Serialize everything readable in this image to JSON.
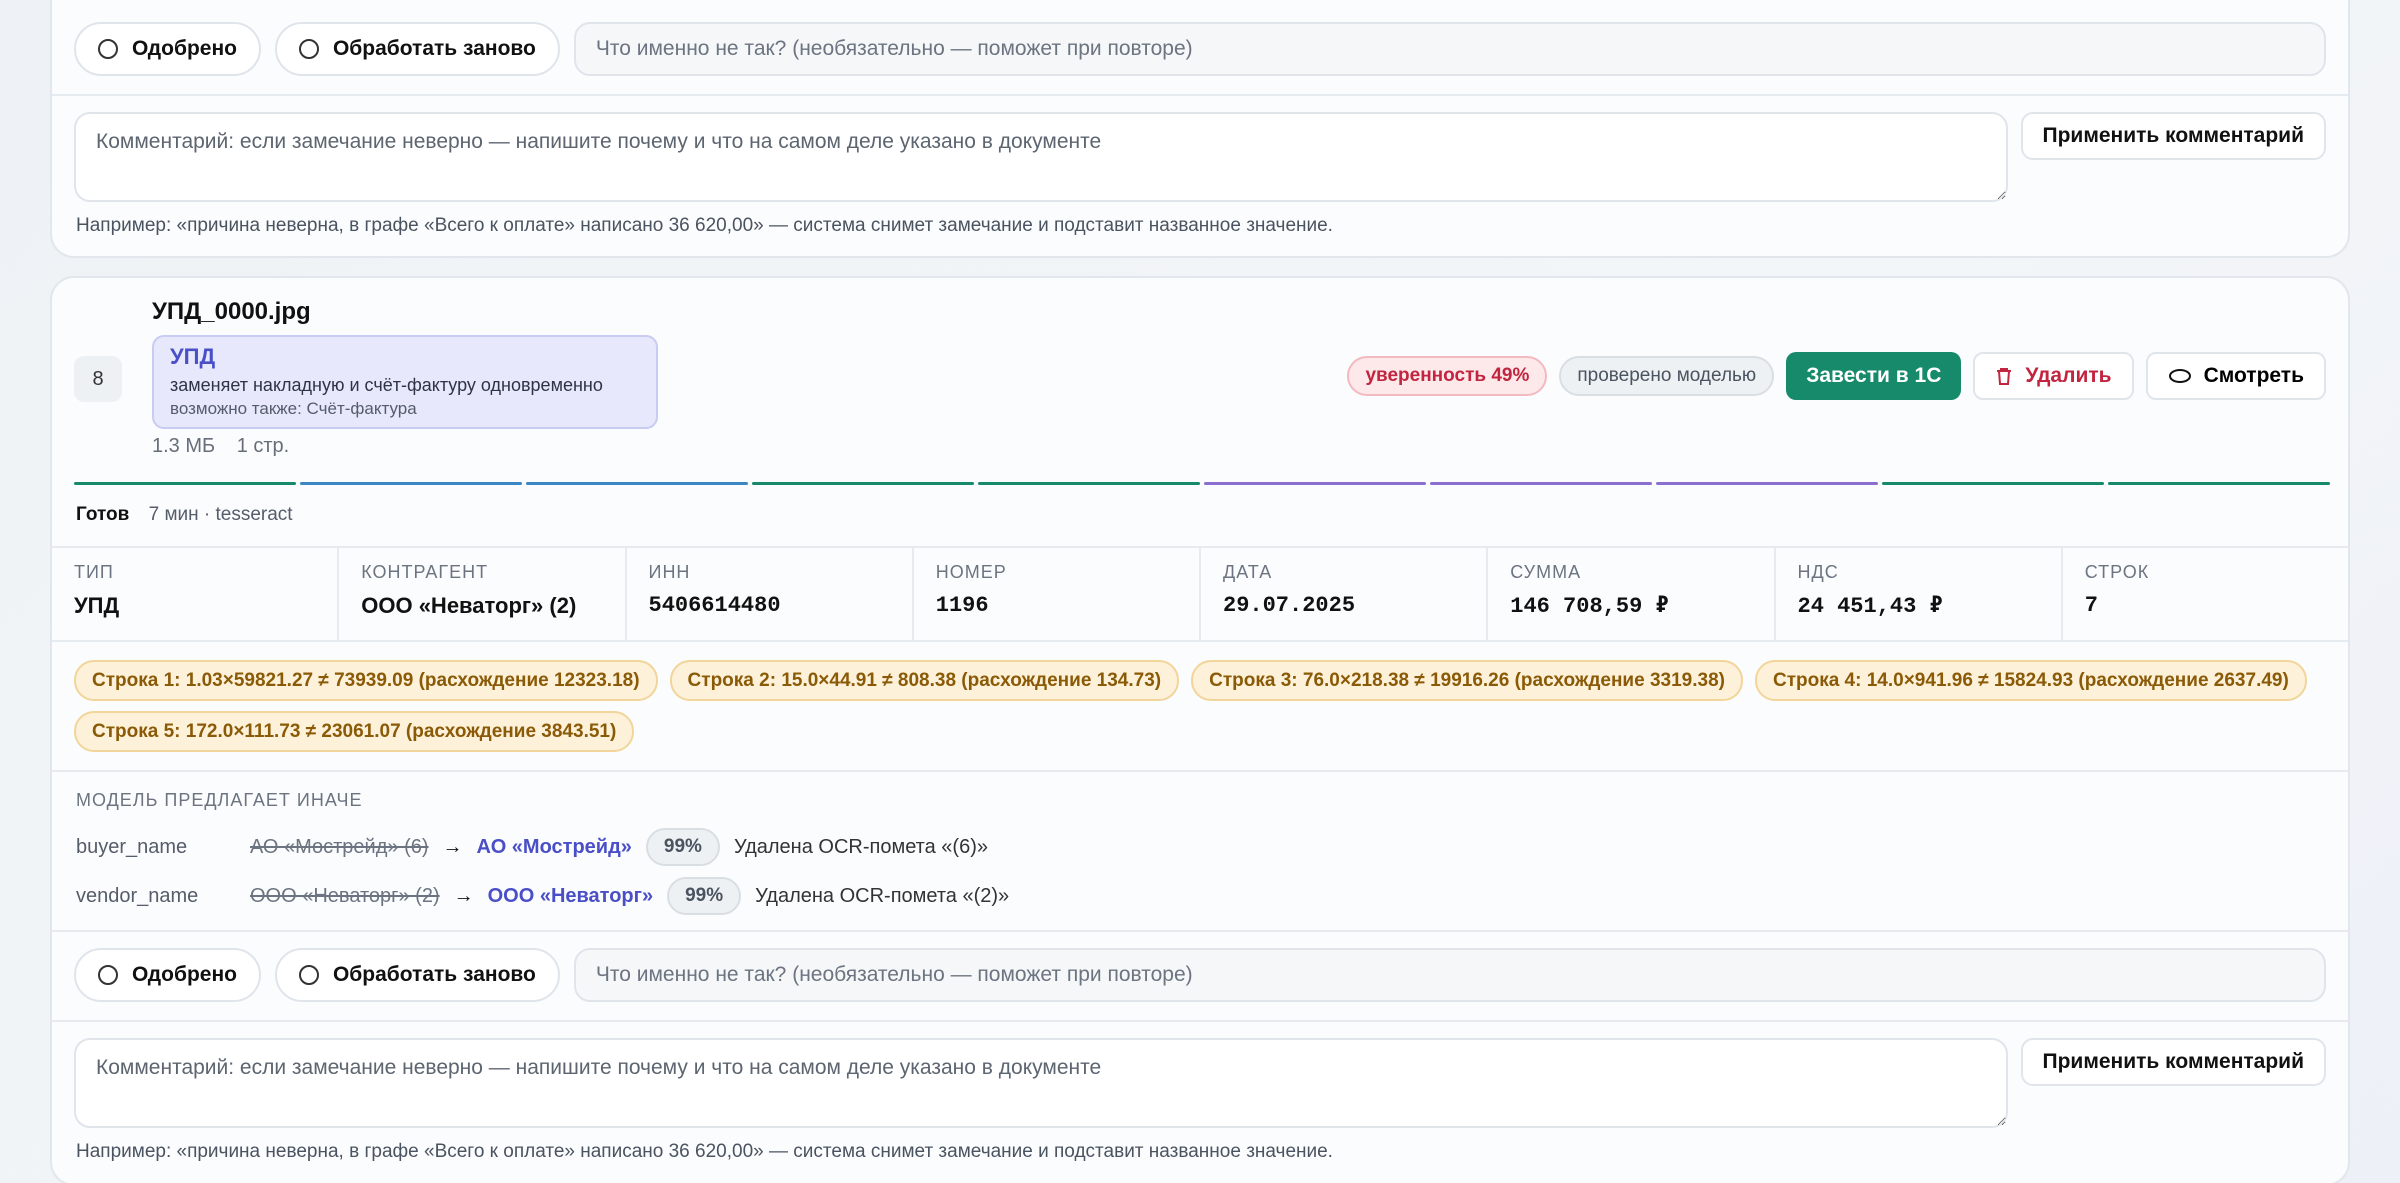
{
  "review": {
    "approved_label": "Одобрено",
    "reprocess_label": "Обработать заново",
    "note_placeholder": "Что именно не так? (необязательно — поможет при повторе)",
    "comment_placeholder": "Комментарий: если замечание неверно — напишите почему и что на самом деле указано в документе",
    "apply_label": "Применить комментарий",
    "hint": "Например: «причина неверна, в графе «Всего к оплате» написано 36 620,00» — система снимет замечание и подставит названное значение."
  },
  "doc": {
    "index": "8",
    "filename": "УПД_0000.jpg",
    "type_title": "УПД",
    "type_desc": "заменяет накладную и счёт-фактуру одновременно",
    "type_also": "возможно также: Счёт-фактура",
    "size": "1.3 МБ",
    "pages": "1 стр.",
    "confidence": "уверенность 49%",
    "checked": "проверено моделью",
    "btn_import": "Завести в 1С",
    "btn_delete": "Удалить",
    "btn_view": "Смотреть",
    "status_label": "Готов",
    "status_meta": "7 мин · tesseract"
  },
  "progress_colors": [
    "#178a6c",
    "#3b86c4",
    "#3b86c4",
    "#178a6c",
    "#178a6c",
    "#8a6fd1",
    "#8a6fd1",
    "#8a6fd1",
    "#178a6c",
    "#178a6c"
  ],
  "fields": [
    {
      "label": "ТИП",
      "value": "УПД"
    },
    {
      "label": "КОНТРАГЕНТ",
      "value": "ООО «Неваторг» (2)"
    },
    {
      "label": "ИНН",
      "value": "5406614480"
    },
    {
      "label": "НОМЕР",
      "value": "1196"
    },
    {
      "label": "ДАТА",
      "value": "29.07.2025"
    },
    {
      "label": "СУММА",
      "value": "146 708,59 ₽"
    },
    {
      "label": "НДС",
      "value": "24 451,43 ₽"
    },
    {
      "label": "СТРОК",
      "value": "7"
    }
  ],
  "warnings": [
    "Строка 1: 1.03×59821.27 ≠ 73939.09 (расхождение 12323.18)",
    "Строка 2: 15.0×44.91 ≠ 808.38 (расхождение 134.73)",
    "Строка 3: 76.0×218.38 ≠ 19916.26 (расхождение 3319.38)",
    "Строка 4: 14.0×941.96 ≠ 15824.93 (расхождение 2637.49)",
    "Строка 5: 172.0×111.73 ≠ 23061.07 (расхождение 3843.51)"
  ],
  "suggest": {
    "title": "МОДЕЛЬ ПРЕДЛАГАЕТ ИНАЧЕ",
    "rows": [
      {
        "field": "buyer_name",
        "old": "АО «Мострейд» (6)",
        "arrow": "→",
        "new": "АО «Мострейд»",
        "pct": "99%",
        "note": "Удалена OCR-помета «(6)»"
      },
      {
        "field": "vendor_name",
        "old": "ООО «Неваторг» (2)",
        "arrow": "→",
        "new": "ООО «Неваторг»",
        "pct": "99%",
        "note": "Удалена OCR-помета «(2)»"
      }
    ]
  }
}
